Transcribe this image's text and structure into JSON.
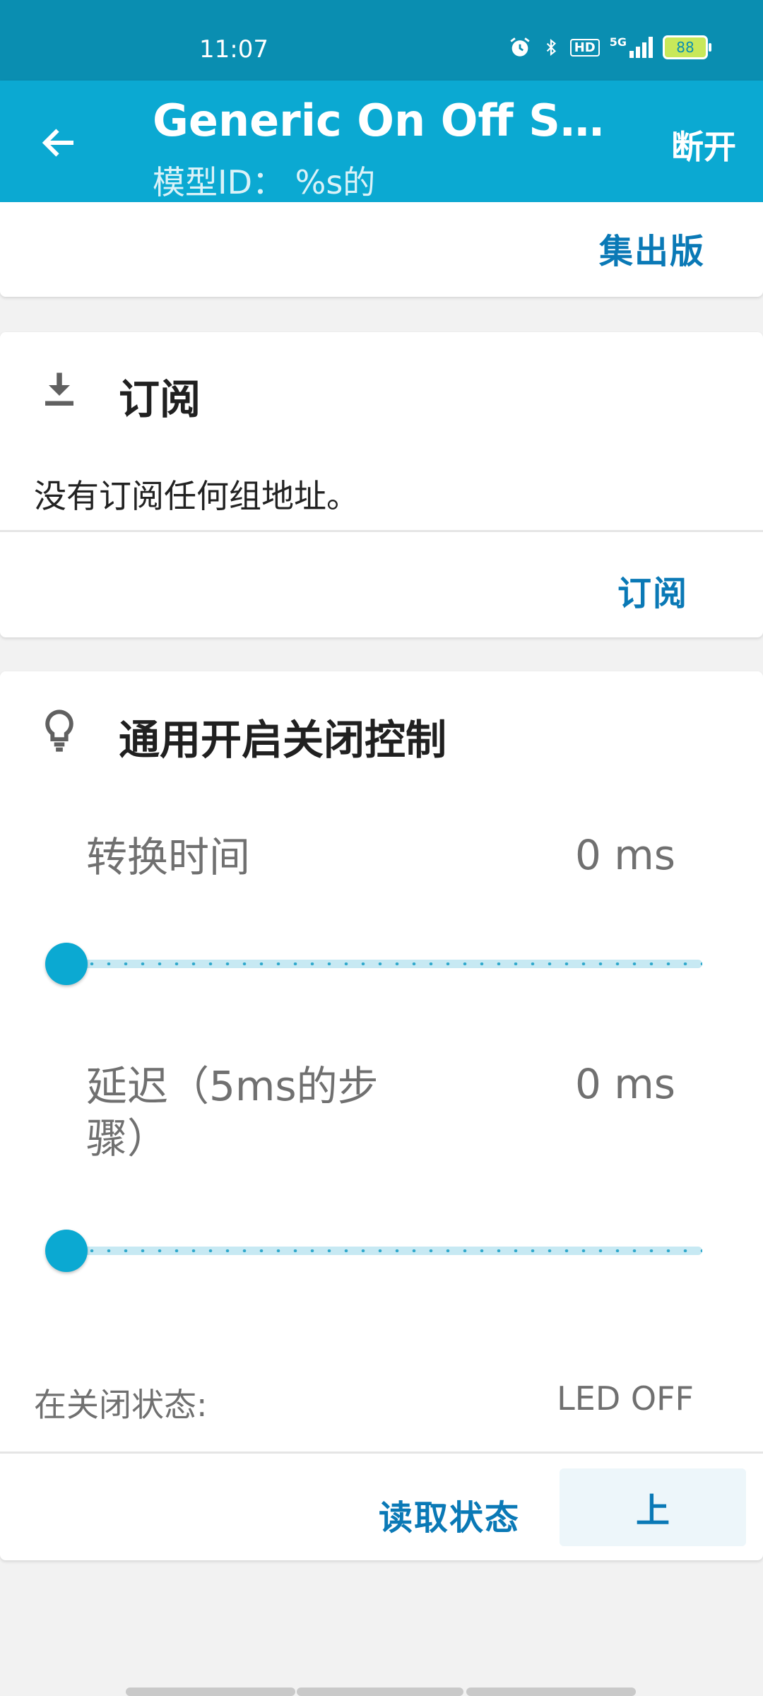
{
  "status_bar": {
    "time": "11:07",
    "battery": "88",
    "hd": "HD",
    "network": "5G",
    "icons": [
      "alarm-icon",
      "bluetooth-icon",
      "hd-icon",
      "signal-icon",
      "battery-icon"
    ]
  },
  "app_bar": {
    "title": "Generic On Off Ser...",
    "subtitle": "模型ID： %s的",
    "action": "断开",
    "back_icon": "arrow-left-icon"
  },
  "publication_card": {
    "action": "集出版"
  },
  "subscription_card": {
    "icon": "download-icon",
    "title": "订阅",
    "message": "没有订阅任何组地址。",
    "action": "订阅"
  },
  "control_card": {
    "icon": "lightbulb-icon",
    "title": "通用开启关闭控制",
    "transition": {
      "label": "转换时间",
      "value": "0 ms",
      "level": 0
    },
    "delay": {
      "label": "延迟（5ms的步骤）",
      "value": "0 ms",
      "level": 0
    },
    "state": {
      "label": "在关闭状态:",
      "value": "LED OFF"
    },
    "read_state_button": "读取状态",
    "set_button": "上"
  },
  "colors": {
    "status_bar": "#0a8eb1",
    "app_bar": "#0ba9d2",
    "accent_text": "#0a79b6",
    "background": "#f2f2f2"
  }
}
